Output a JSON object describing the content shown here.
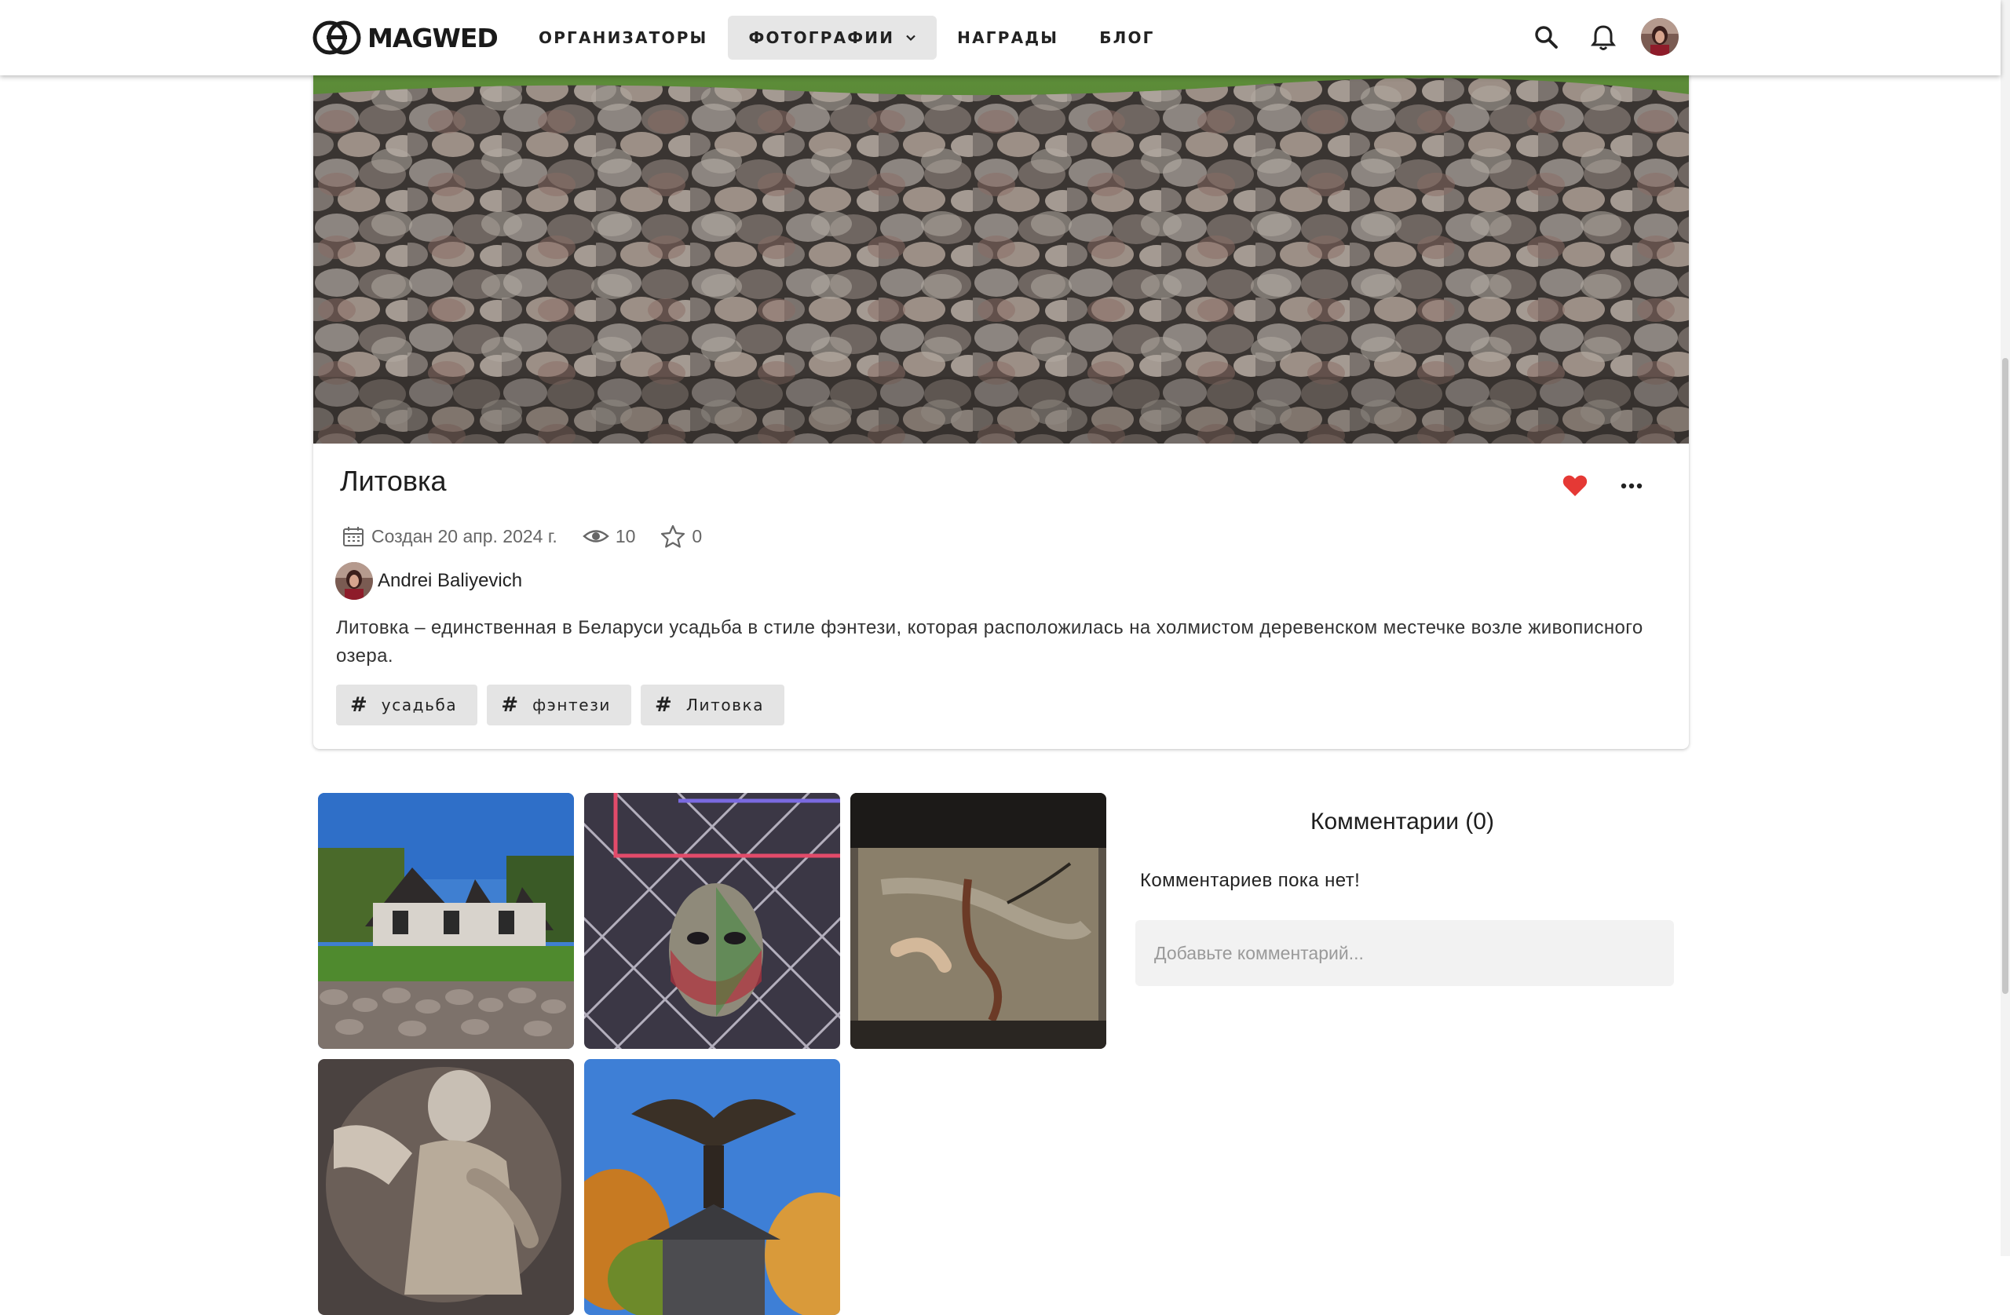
{
  "header": {
    "logo_text": "MAGWED",
    "nav": [
      {
        "label": "ОРГАНИЗАТОРЫ"
      },
      {
        "label": "ФОТОГРАФИИ",
        "has_dropdown": true,
        "active": true
      },
      {
        "label": "НАГРАДЫ"
      },
      {
        "label": "БЛОГ"
      }
    ]
  },
  "album": {
    "title": "Литовка",
    "created": "Создан 20 апр. 2024 г.",
    "views": "10",
    "stars": "0",
    "liked": true,
    "author": "Andrei Baliyevich",
    "description": "Литовка – единственная в Беларуси усадьба в стиле фэнтези, которая расположилась на холмистом деревенском местечке возле живописного озера.",
    "tags": [
      "усадьба",
      "фэнтези",
      "Литовка"
    ]
  },
  "comments": {
    "title": "Комментарии (0)",
    "empty_text": "Комментариев пока нет!",
    "input_placeholder": "Добавьте комментарий..."
  },
  "colors": {
    "accent_like": "#e53935",
    "tag_bg": "#e4e4e4",
    "active_nav_bg": "#e6e6e6"
  },
  "icons": {
    "search": "search-icon",
    "notifications": "bell-icon",
    "calendar": "calendar-icon",
    "views": "eye-icon",
    "stars": "star-icon",
    "like": "heart-icon",
    "more": "more-horizontal-icon",
    "tag": "hash-icon"
  }
}
